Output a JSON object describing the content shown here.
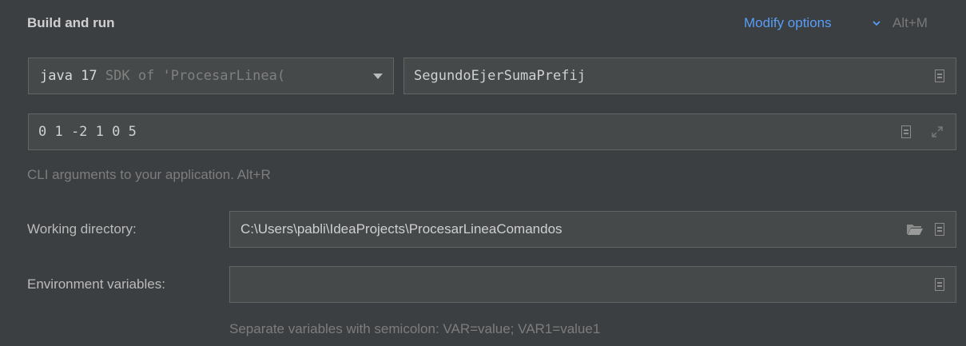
{
  "section": {
    "title": "Build and run"
  },
  "modify_options": {
    "label": "Modify options",
    "shortcut": "Alt+M"
  },
  "jdk": {
    "name": "java 17",
    "description": "SDK of 'ProcesarLinea("
  },
  "main_class": {
    "value": "SegundoEjerSumaPrefij"
  },
  "program_arguments": {
    "value": "0 1 -2 1 0 5",
    "hint": "CLI arguments to your application. Alt+R"
  },
  "working_directory": {
    "label": "Working directory:",
    "value": "C:\\Users\\pabli\\IdeaProjects\\ProcesarLineaComandos"
  },
  "environment_variables": {
    "label": "Environment variables:",
    "value": "",
    "hint": "Separate variables with semicolon: VAR=value; VAR1=value1"
  },
  "icons": [
    "chevron-down-icon",
    "dropdown-arrow-icon",
    "document-icon",
    "expand-icon",
    "folder-icon"
  ],
  "colors": {
    "background": "#3c3f41",
    "field": "#45494a",
    "border": "#646464",
    "link": "#589df6"
  }
}
